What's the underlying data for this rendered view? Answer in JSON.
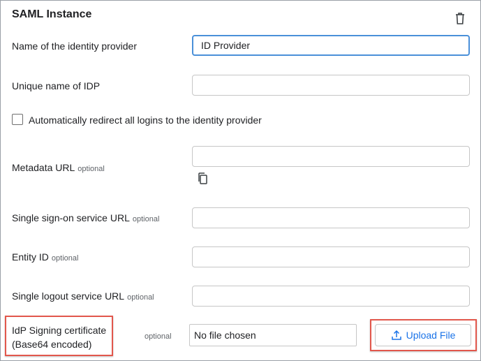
{
  "panel": {
    "title": "SAML Instance",
    "delete_icon": "trash-icon"
  },
  "fields": {
    "idp_name": {
      "label": "Name of the identity provider",
      "value": "ID Provider"
    },
    "idp_unique": {
      "label": "Unique name of IDP",
      "value": ""
    },
    "auto_redirect": {
      "label": "Automatically redirect all logins to the identity provider",
      "checked": false
    },
    "metadata_url": {
      "label": "Metadata URL",
      "optional": "optional",
      "value": "",
      "copy_icon": "copy-icon"
    },
    "sso_url": {
      "label": "Single sign-on service URL",
      "optional": "optional",
      "value": ""
    },
    "entity_id": {
      "label": "Entity ID",
      "optional": "optional",
      "value": ""
    },
    "slo_url": {
      "label": "Single logout service URL",
      "optional": "optional",
      "value": ""
    },
    "signing_cert": {
      "label_line1": "IdP Signing certificate",
      "label_line2": "(Base64 encoded)",
      "optional": "optional",
      "file_status": "No file chosen",
      "upload_label": "Upload File",
      "upload_icon": "upload-icon"
    }
  },
  "colors": {
    "focus_border": "#4a90d9",
    "highlight": "#e2574c",
    "link_blue": "#1a73e8"
  }
}
